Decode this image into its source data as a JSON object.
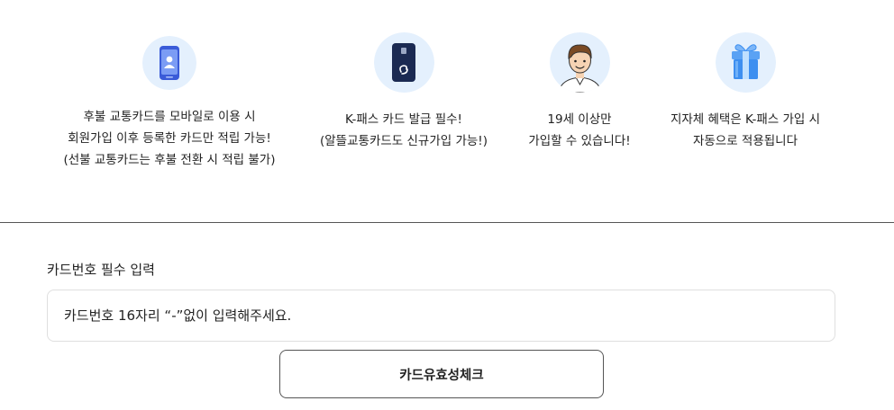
{
  "info_items": [
    {
      "icon": "mobile-card-icon",
      "lines": [
        "후불 교통카드를 모바일로 이용 시",
        "회원가입 이후 등록한 카드만 적립 가능!",
        "(선불 교통카드는 후불 전환 시 적립 불가)"
      ]
    },
    {
      "icon": "k-pass-card-icon",
      "lines": [
        "K-패스 카드 발급 필수!",
        "(알뜰교통카드도 신규가입 가능!)"
      ]
    },
    {
      "icon": "person-icon",
      "lines": [
        "19세 이상만",
        "가입할 수 있습니다!"
      ]
    },
    {
      "icon": "gift-icon",
      "lines": [
        "지자체 혜택은 K-패스 가입 시",
        "자동으로 적용됩니다"
      ]
    }
  ],
  "card_form": {
    "label": "카드번호 필수 입력",
    "input_placeholder": "카드번호 16자리 “-”없이 입력해주세요.",
    "input_value": "",
    "check_button_label": "카드유효성체크"
  },
  "colors": {
    "icon_bg": "#e4f0fd",
    "card_navy": "#1b2a52",
    "gift_blue": "#3d8ff0",
    "divider": "#555555",
    "input_border": "#dfdfdf"
  }
}
